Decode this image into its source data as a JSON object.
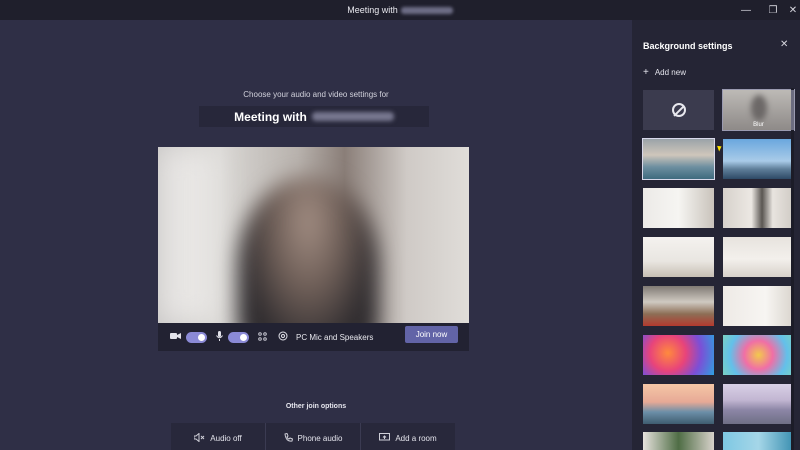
{
  "titlebar": {
    "title": "Meeting with",
    "controls": [
      {
        "name": "minimize",
        "glyph": "—"
      },
      {
        "name": "maximize",
        "glyph": "❐"
      },
      {
        "name": "close",
        "glyph": "✕"
      }
    ]
  },
  "main": {
    "prompt": "Choose your audio and video settings for",
    "meeting_title": "Meeting with",
    "controls": {
      "audio_device": "PC Mic and Speakers",
      "join_label": "Join now"
    },
    "other_options_label": "Other join options",
    "join_options": [
      {
        "icon": "speaker-off-icon",
        "label": "Audio off"
      },
      {
        "icon": "phone-icon",
        "label": "Phone audio"
      },
      {
        "icon": "cast-icon",
        "label": "Add a room"
      }
    ]
  },
  "panel": {
    "title": "Background settings",
    "add_new": "Add new",
    "blur_label": "Blur"
  },
  "colors": {
    "accent": "#6264a7",
    "toggle_on": "#8b8ad6",
    "panel_bg": "#252535",
    "main_bg": "#2f2f46"
  }
}
